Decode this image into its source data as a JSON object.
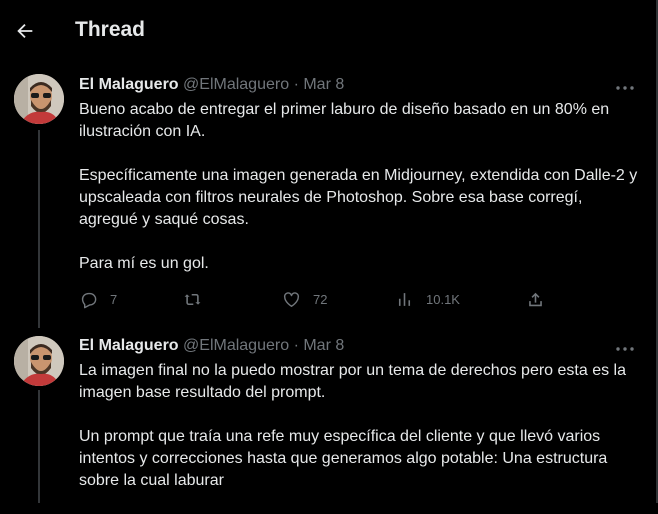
{
  "header": {
    "title": "Thread",
    "back_icon": "arrow-left-icon"
  },
  "tweets": [
    {
      "author_name": "El Malaguero",
      "handle": "@ElMalaguero",
      "separator": "·",
      "date": "Mar 8",
      "paragraphs": [
        "Bueno acabo de entregar el primer laburo de diseño basado en un 80% en ilustración con IA.",
        "Específicamente una imagen generada en Midjourney, extendida con Dalle-2 y upscaleada con filtros neurales de Photoshop. Sobre esa base corregí, agregué y saqué cosas.",
        "Para mí es un gol."
      ],
      "actions": {
        "replies": "7",
        "retweets": "",
        "likes": "72",
        "views": "10.1K"
      }
    },
    {
      "author_name": "El Malaguero",
      "handle": "@ElMalaguero",
      "separator": "·",
      "date": "Mar 8",
      "paragraphs": [
        "La imagen final no la puedo mostrar por un tema de derechos pero esta es la imagen base resultado del prompt.",
        "Un prompt que traía una refe muy específica del cliente y que llevó varios intentos y correcciones hasta que generamos algo potable: Una estructura sobre la cual laburar"
      ]
    }
  ],
  "colors": {
    "background": "#000000",
    "text": "#e7e9ea",
    "muted": "#71767b",
    "line": "#333639"
  }
}
